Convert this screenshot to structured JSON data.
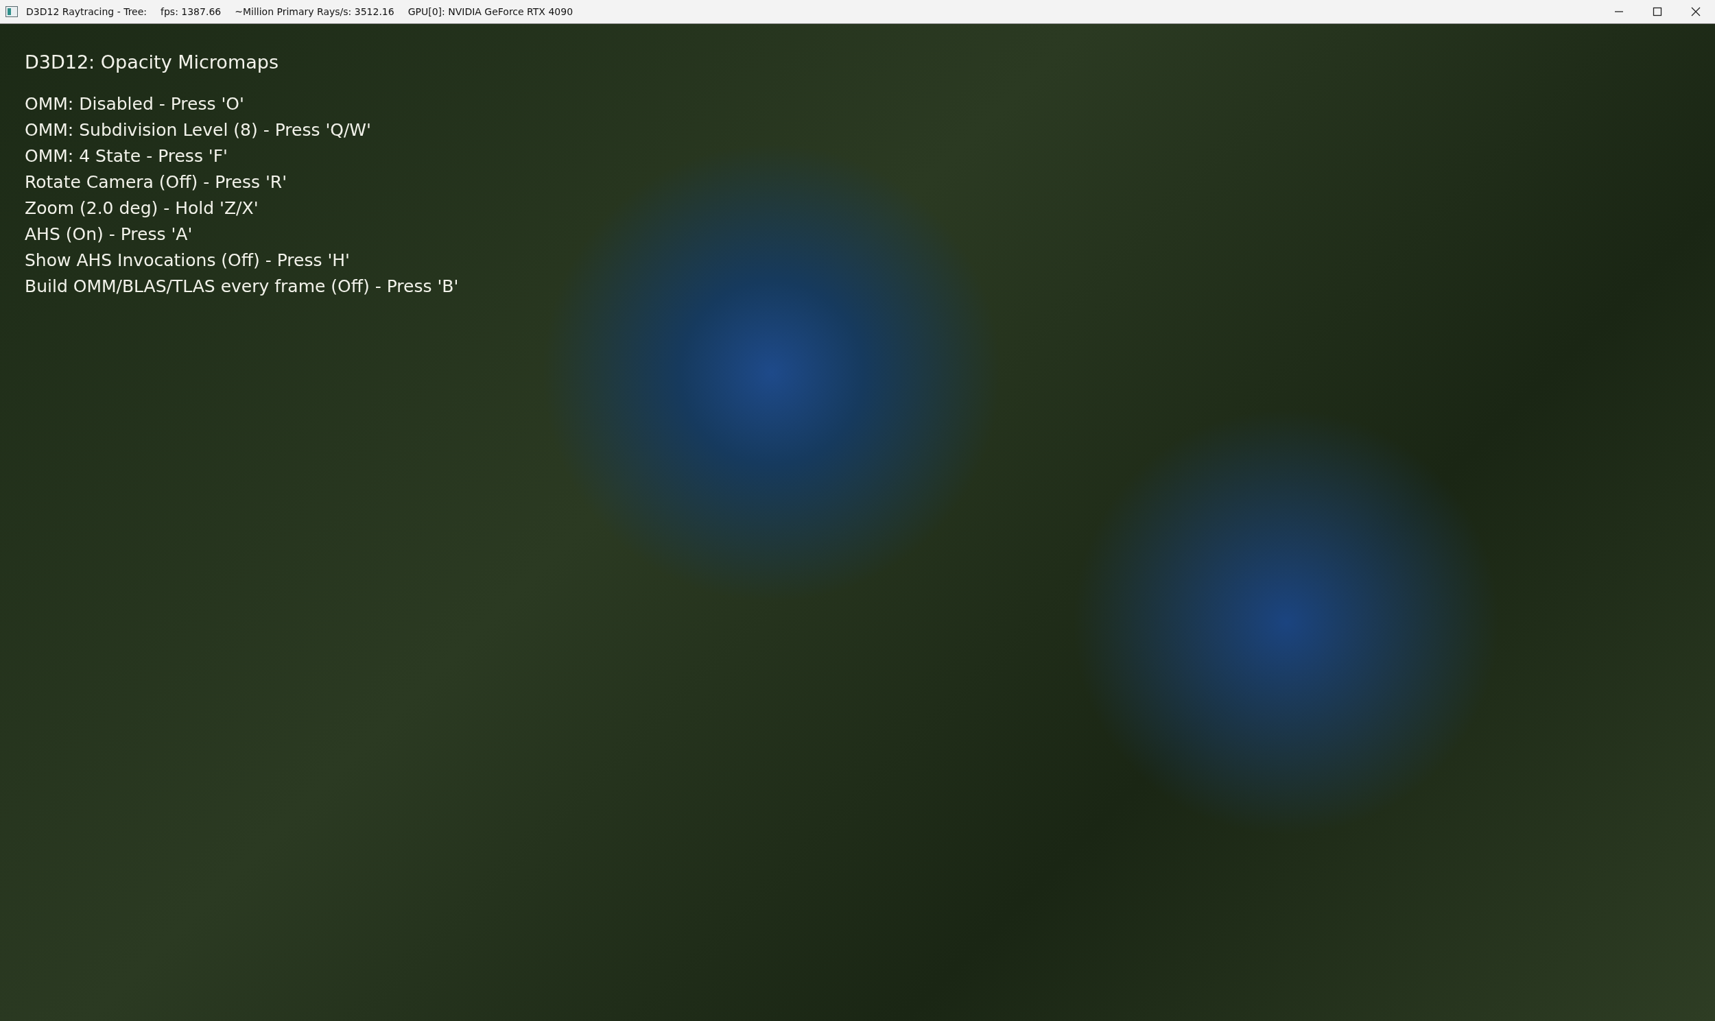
{
  "window": {
    "title_parts": [
      "D3D12 Raytracing - Tree:",
      "fps: 1387.66",
      "~Million Primary Rays/s: 3512.16",
      "GPU[0]: NVIDIA GeForce RTX 4090"
    ]
  },
  "overlay": {
    "heading": "D3D12: Opacity Micromaps",
    "lines": [
      "OMM: Disabled - Press 'O'",
      "OMM: Subdivision Level (8) - Press 'Q/W'",
      "OMM: 4 State - Press 'F'",
      "Rotate Camera (Off) - Press 'R'",
      "Zoom (2.0 deg) - Hold 'Z/X'",
      "AHS (On) - Press 'A'",
      "Show AHS Invocations (Off) - Press 'H'",
      "Build OMM/BLAS/TLAS every frame (Off) - Press 'B'"
    ]
  }
}
